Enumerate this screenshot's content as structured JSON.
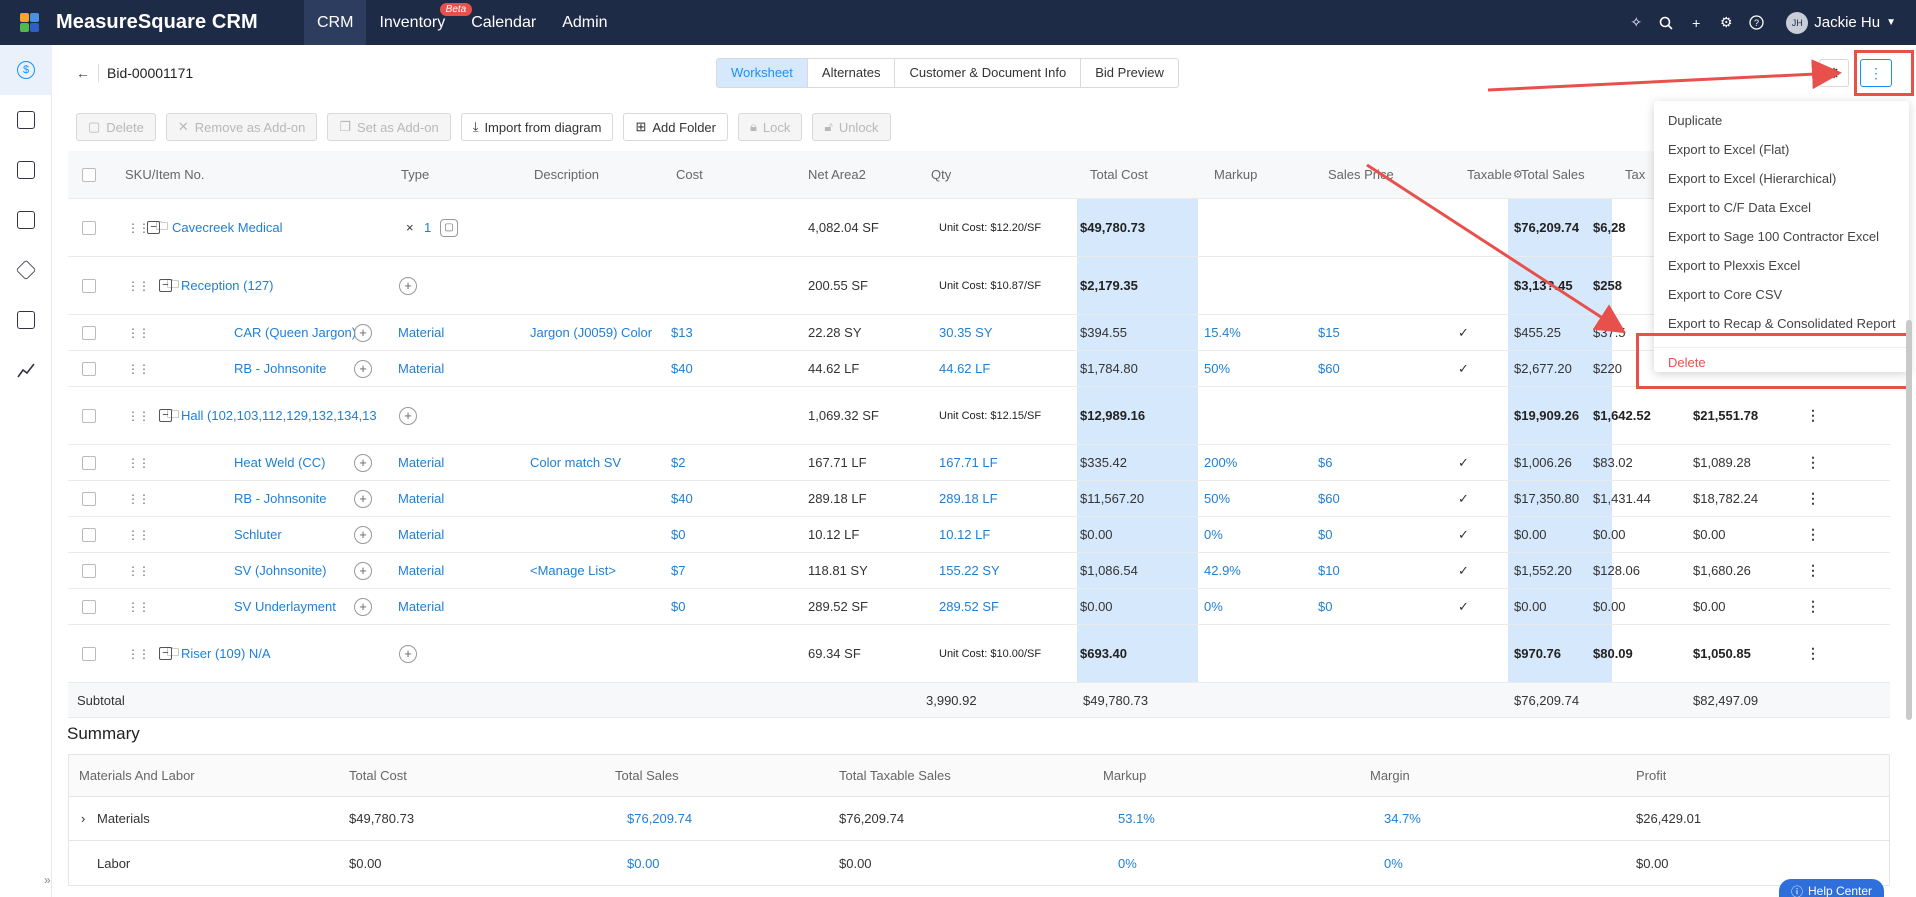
{
  "app": {
    "brand": "MeasureSquare CRM"
  },
  "nav": [
    {
      "label": "CRM",
      "active": true
    },
    {
      "label": "Inventory",
      "badge": "Beta"
    },
    {
      "label": "Calendar"
    },
    {
      "label": "Admin"
    }
  ],
  "user": {
    "initials": "JH",
    "name": "Jackie Hu"
  },
  "icons": {
    "top": [
      "sparkle-icon",
      "search-icon",
      "plus-icon",
      "settings-icon",
      "help-icon"
    ],
    "sidebar": [
      "dollar-icon",
      "document-list-icon",
      "estimate-icon",
      "calendar-icon",
      "box-icon",
      "presentation-icon",
      "chart-icon"
    ]
  },
  "header": {
    "bid_no": "Bid-00001171"
  },
  "tabs": [
    "Worksheet",
    "Alternates",
    "Customer & Document Info",
    "Bid Preview"
  ],
  "toolbar": {
    "delete": "Delete",
    "remove_addon": "Remove as Add-on",
    "set_addon": "Set as Add-on",
    "import": "Import from diagram",
    "add_folder": "Add Folder",
    "lock": "Lock",
    "unlock": "Unlock"
  },
  "columns": [
    "SKU/Item No.",
    "Type",
    "Description",
    "Cost",
    "Net Area2",
    "Qty",
    "Total Cost",
    "Markup",
    "Sales Price",
    "Taxable",
    "Total Sales",
    "Tax"
  ],
  "rows": [
    {
      "level": 0,
      "kind": "folder",
      "name": "Cavecreek Medical",
      "mult": "×",
      "count": "1",
      "area": "4,082.04 SF",
      "unit_cost": "Unit Cost: $12.20/SF",
      "total_cost": "$49,780.73",
      "total_sales": "$76,209.74",
      "tax": "$6,28",
      "total": ""
    },
    {
      "level": 1,
      "kind": "folder",
      "name": "Reception (127)",
      "area": "200.55 SF",
      "unit_cost": "Unit Cost: $10.87/SF",
      "total_cost": "$2,179.35",
      "total_sales": "$3,13?.45",
      "tax": "$258",
      "total": ""
    },
    {
      "level": 2,
      "kind": "item",
      "name": "CAR (Queen Jargon)",
      "type": "Material",
      "desc": "Jargon (J0059) Color",
      "cost": "$13",
      "area": "22.28 SY",
      "qty": "30.35 SY",
      "total_cost": "$394.55",
      "markup": "15.4%",
      "price": "$15",
      "taxable": "✓",
      "total_sales": "$455.25",
      "tax": "$37.5",
      "total": ""
    },
    {
      "level": 2,
      "kind": "item",
      "name": "RB - Johnsonite",
      "type": "Material",
      "desc": "",
      "cost": "$40",
      "area": "44.62 LF",
      "qty": "44.62 LF",
      "total_cost": "$1,784.80",
      "markup": "50%",
      "price": "$60",
      "taxable": "✓",
      "total_sales": "$2,677.20",
      "tax": "$220",
      "total": ""
    },
    {
      "level": 1,
      "kind": "folder",
      "name": "Hall (102,103,112,129,132,134,13",
      "area": "1,069.32 SF",
      "unit_cost": "Unit Cost: $12.15/SF",
      "total_cost": "$12,989.16",
      "total_sales": "$19,909.26",
      "tax": "$1,642.52",
      "total": "$21,551.78"
    },
    {
      "level": 2,
      "kind": "item",
      "name": "Heat Weld (CC)",
      "type": "Material",
      "desc": "Color match SV",
      "cost": "$2",
      "area": "167.71 LF",
      "qty": "167.71 LF",
      "total_cost": "$335.42",
      "markup": "200%",
      "price": "$6",
      "taxable": "✓",
      "total_sales": "$1,006.26",
      "tax": "$83.02",
      "total": "$1,089.28"
    },
    {
      "level": 2,
      "kind": "item",
      "name": "RB - Johnsonite",
      "type": "Material",
      "desc": "",
      "cost": "$40",
      "area": "289.18 LF",
      "qty": "289.18 LF",
      "total_cost": "$11,567.20",
      "markup": "50%",
      "price": "$60",
      "taxable": "✓",
      "total_sales": "$17,350.80",
      "tax": "$1,431.44",
      "total": "$18,782.24"
    },
    {
      "level": 2,
      "kind": "item",
      "name": "Schluter",
      "type": "Material",
      "desc": "",
      "cost": "$0",
      "area": "10.12 LF",
      "qty": "10.12 LF",
      "total_cost": "$0.00",
      "markup": "0%",
      "price": "$0",
      "taxable": "✓",
      "total_sales": "$0.00",
      "tax": "$0.00",
      "total": "$0.00"
    },
    {
      "level": 2,
      "kind": "item",
      "name": "SV (Johnsonite)",
      "type": "Material",
      "desc": "<Manage List>",
      "cost": "$7",
      "area": "118.81 SY",
      "qty": "155.22 SY",
      "total_cost": "$1,086.54",
      "markup": "42.9%",
      "price": "$10",
      "taxable": "✓",
      "total_sales": "$1,552.20",
      "tax": "$128.06",
      "total": "$1,680.26"
    },
    {
      "level": 2,
      "kind": "item",
      "name": "SV Underlayment",
      "type": "Material",
      "desc": "",
      "cost": "$0",
      "area": "289.52 SF",
      "qty": "289.52 SF",
      "total_cost": "$0.00",
      "markup": "0%",
      "price": "$0",
      "taxable": "✓",
      "total_sales": "$0.00",
      "tax": "$0.00",
      "total": "$0.00"
    },
    {
      "level": 1,
      "kind": "folder",
      "name": "Riser (109) N/A",
      "area": "69.34 SF",
      "unit_cost": "Unit Cost: $10.00/SF",
      "total_cost": "$693.40",
      "total_sales": "$970.76",
      "tax": "$80.09",
      "total": "$1,050.85"
    }
  ],
  "subtotal": {
    "label": "Subtotal",
    "qty": "3,990.92",
    "total_cost": "$49,780.73",
    "total_sales": "$76,209.74",
    "total": "$82,497.09"
  },
  "summary": {
    "title": "Summary",
    "columns": [
      "Materials And Labor",
      "Total Cost",
      "Total Sales",
      "Total Taxable Sales",
      "Markup",
      "Margin",
      "Profit"
    ],
    "rows": [
      {
        "name": "Materials",
        "expander": "›",
        "total_cost": "$49,780.73",
        "total_sales": "$76,209.74",
        "taxable": "$76,209.74",
        "markup": "53.1%",
        "margin": "34.7%",
        "profit": "$26,429.01"
      },
      {
        "name": "Labor",
        "expander": "",
        "total_cost": "$0.00",
        "total_sales": "$0.00",
        "taxable": "$0.00",
        "markup": "0%",
        "margin": "0%",
        "profit": "$0.00"
      }
    ]
  },
  "menu": {
    "items": [
      "Duplicate",
      "Export to Excel (Flat)",
      "Export to Excel (Hierarchical)",
      "Export to C/F Data Excel",
      "Export to Sage 100 Contractor Excel",
      "Export to Plexxis Excel",
      "Export to Core CSV",
      "Export to Recap & Consolidated Report"
    ],
    "danger": "Delete"
  },
  "help": {
    "label": "Help Center"
  },
  "colors": {
    "topbar": "#1e2b47",
    "accent": "#1890ff",
    "link": "#1e7fd6",
    "band": "#d6e8fb",
    "annotation": "#e8504c"
  }
}
